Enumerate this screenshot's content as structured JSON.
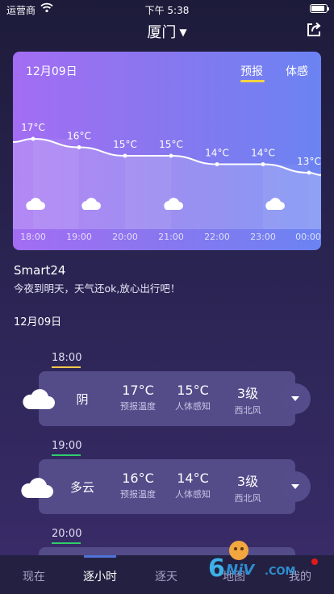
{
  "status_bar": {
    "carrier": "运营商",
    "time": "下午 5:38",
    "battery_level": 0.9
  },
  "header": {
    "city": "厦门",
    "caret": "▼"
  },
  "forecast_card": {
    "date": "12月09日",
    "tabs": [
      {
        "label": "预报",
        "selected": true
      },
      {
        "label": "体感",
        "selected": false
      }
    ],
    "hours": [
      {
        "time": "18:00",
        "temp": "17°C",
        "temp_value": 17,
        "icon": "cloud-icon"
      },
      {
        "time": "19:00",
        "temp": "16°C",
        "temp_value": 16,
        "icon": "partly-cloudy-icon"
      },
      {
        "time": "20:00",
        "temp": "15°C",
        "temp_value": 15,
        "icon": ""
      },
      {
        "time": "21:00",
        "temp": "15°C",
        "temp_value": 15,
        "icon": "cloud-icon"
      },
      {
        "time": "22:00",
        "temp": "14°C",
        "temp_value": 14,
        "icon": ""
      },
      {
        "time": "23:00",
        "temp": "14°C",
        "temp_value": 14,
        "icon": "partly-cloudy-icon"
      },
      {
        "time": "00:00",
        "temp": "13°C",
        "temp_value": 13,
        "icon": ""
      }
    ]
  },
  "summary": {
    "name": "Smart24",
    "message": "今夜到明天，天气还ok,放心出行吧！"
  },
  "list": {
    "date": "12月09日",
    "slots": [
      {
        "time": "18:00",
        "line_color": "#f2c94c",
        "condition": "阴",
        "icon": "cloud-icon",
        "forecast_temp": "17°C",
        "forecast_label": "预报温度",
        "feel_temp": "15°C",
        "feel_label": "人体感知",
        "wind_level": "3级",
        "wind_dir": "西北风"
      },
      {
        "time": "19:00",
        "line_color": "#2fcf6b",
        "condition": "多云",
        "icon": "partly-cloudy-icon",
        "forecast_temp": "16°C",
        "forecast_label": "预报温度",
        "feel_temp": "14°C",
        "feel_label": "人体感知",
        "wind_level": "3级",
        "wind_dir": "西北风"
      },
      {
        "time": "20:00",
        "line_color": "#2fcf6b"
      }
    ]
  },
  "tab_bar": {
    "items": [
      {
        "label": "现在",
        "active": false
      },
      {
        "label": "逐小时",
        "active": true
      },
      {
        "label": "逐天",
        "active": false
      },
      {
        "label": "地图",
        "active": false
      },
      {
        "label": "我的",
        "active": false
      }
    ]
  },
  "watermark": {
    "text": "6NiV.COM"
  },
  "colors": {
    "accent": "#4e74d8",
    "underline": "#f3d544"
  }
}
